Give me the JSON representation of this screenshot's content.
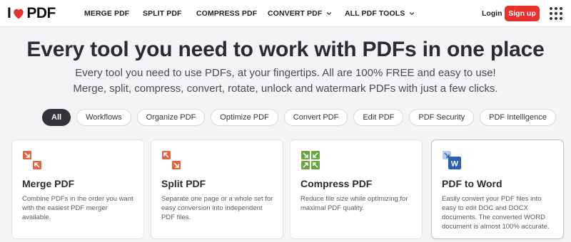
{
  "brand": {
    "name_left": "I",
    "name_right": "PDF",
    "accent": "#e5322d"
  },
  "nav": {
    "items": [
      {
        "label": "MERGE PDF"
      },
      {
        "label": "SPLIT PDF"
      },
      {
        "label": "COMPRESS PDF"
      },
      {
        "label": "CONVERT PDF"
      },
      {
        "label": "ALL PDF TOOLS"
      }
    ],
    "login_label": "Login",
    "signup_label": "Sign up"
  },
  "hero": {
    "title": "Every tool you need to work with PDFs in one place",
    "subtitle": "Every tool you need to use PDFs, at your fingertips. All are 100% FREE and easy to use! Merge, split, compress, convert, rotate, unlock and watermark PDFs with just a few clicks."
  },
  "filters": [
    "All",
    "Workflows",
    "Organize PDF",
    "Optimize PDF",
    "Convert PDF",
    "Edit PDF",
    "PDF Security",
    "PDF Intelligence"
  ],
  "cards": [
    {
      "title": "Merge PDF",
      "desc": "Combine PDFs in the order you want with the easiest PDF merger available.",
      "icon": "merge-icon",
      "color": "#e5633f"
    },
    {
      "title": "Split PDF",
      "desc": "Separate one page or a whole set for easy conversion into independent PDF files.",
      "icon": "split-icon",
      "color": "#e5633f"
    },
    {
      "title": "Compress PDF",
      "desc": "Reduce file size while optimizing for maximal PDF quality.",
      "icon": "compress-icon",
      "color": "#6ba540"
    },
    {
      "title": "PDF to Word",
      "desc": "Easily convert your PDF files into easy to edit DOC and DOCX documents. The converted WORD document is almost 100% accurate.",
      "icon": "word-icon",
      "color": "#2b5fb4",
      "icon_letter": "W"
    }
  ]
}
